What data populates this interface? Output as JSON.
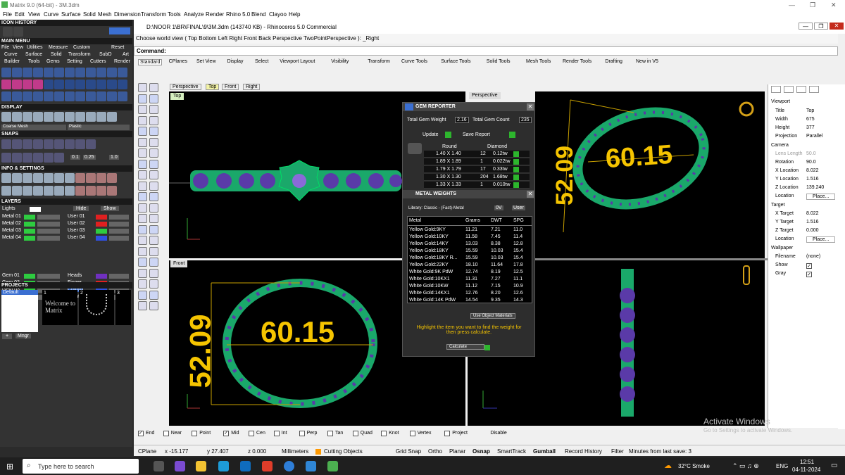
{
  "window": {
    "title": "Matrix 9.0 (64-bit) - 3M.3dm"
  },
  "menu": [
    "File",
    "Edit",
    "View",
    "Curve",
    "Surface",
    "Solid",
    "Mesh",
    "Dimension",
    "Transform",
    "Tools",
    "Analyze",
    "Render",
    "Rhino 5.0",
    "Blend",
    "Clayoo",
    "Help"
  ],
  "left": {
    "icon_history": "ICON HISTORY",
    "main_menu": "MAIN MENU",
    "main_menu_items": [
      "File",
      "View",
      "Utilities",
      "Measure",
      "Custom",
      "Reset"
    ],
    "row2": [
      "Curve",
      "Surface",
      "Solid",
      "Transform",
      "SubD",
      "Art"
    ],
    "row3": [
      "Builder",
      "Tools",
      "Gems",
      "Setting",
      "Cutters",
      "Render"
    ],
    "display": "DISPLAY",
    "display_modes": [
      "Coarse Mesh",
      "Plastic"
    ],
    "snaps": "SNAPS",
    "snap_vals": [
      "0.1",
      "0.25",
      "1.0"
    ],
    "info": "INFO & SETTINGS",
    "layers": "LAYERS",
    "lights": "Lights",
    "hide": "Hide",
    "show": "Show",
    "layer_names": [
      "Metal 01",
      "Metal 02",
      "Metal 03",
      "Metal 04",
      "Gem 01",
      "Gem 02",
      "Gem 03",
      "Gem 04"
    ],
    "user_names": [
      "User 01",
      "User 02",
      "User 03",
      "User 04",
      "Heads",
      "Finger",
      "Cutting",
      "Creation"
    ],
    "projects": "PROJECTS",
    "default": "Default",
    "thumbs": [
      "1",
      "2",
      "3"
    ],
    "welcome": "Welcome to Matrix",
    "mngr": "Mngr"
  },
  "rhino": {
    "title": "D:\\NOOR 1\\BR\\FINAL\\9\\3M.3dm (143740 KB) - Rhinoceros 5.0 Commercial",
    "cmd_history": "Choose world view ( Top  Bottom  Left  Right  Front  Back  Perspective  TwoPointPerspective ): _Right",
    "command_label": "Command:",
    "tabs": [
      "Standard",
      "CPlanes",
      "Set View",
      "Display",
      "Select",
      "Viewport Layout",
      "Visibility",
      "Transform",
      "Curve Tools",
      "Surface Tools",
      "Solid Tools",
      "Mesh Tools",
      "Render Tools",
      "Drafting",
      "New in V5"
    ],
    "vp_tabs": [
      "Perspective",
      "Top",
      "Front",
      "Right"
    ],
    "vp_top": "Top",
    "vp_persp": "Perspective",
    "vp_front": "Front",
    "dim_w": "60.15",
    "dim_h": "52.09"
  },
  "gem": {
    "title": "GEM REPORTER",
    "tgw_label": "Total Gem Weight",
    "tgw": "2.16",
    "tgc_label": "Total Gem Count",
    "tgc": "235",
    "update": "Update",
    "save": "Save Report",
    "col_round": "Round",
    "col_diamond": "Diamond",
    "rows": [
      {
        "size": "1.40 X 1.40",
        "count": "12",
        "tw": "0.12tw"
      },
      {
        "size": "1.89 X 1.89",
        "count": "1",
        "tw": "0.022tw"
      },
      {
        "size": "1.79 X 1.79",
        "count": "17",
        "tw": "0.33tw"
      },
      {
        "size": "1.30 X 1.30",
        "count": "204",
        "tw": "1.68tw"
      },
      {
        "size": "1.33 X 1.33",
        "count": "1",
        "tw": "0.010tw"
      }
    ],
    "metal_title": "METAL WEIGHTS",
    "library": "Library: Classic - (Fast)-Metal",
    "ov": "0V",
    "user": "User",
    "mcols": [
      "Metal",
      "Grams",
      "DWT",
      "SPG"
    ],
    "metals": [
      [
        "Yellow Gold:9KY",
        "11.21",
        "7.21",
        "11.0"
      ],
      [
        "Yellow Gold:10KY",
        "11.58",
        "7.45",
        "11.4"
      ],
      [
        "Yellow Gold:14KY",
        "13.03",
        "8.38",
        "12.8"
      ],
      [
        "Yellow Gold:18KY",
        "15.59",
        "10.03",
        "15.4"
      ],
      [
        "Yellow Gold:18KY R...",
        "15.59",
        "10.03",
        "15.4"
      ],
      [
        "Yellow Gold:22KY",
        "18.10",
        "11.64",
        "17.8"
      ],
      [
        "White Gold:9K PdW",
        "12.74",
        "8.19",
        "12.5"
      ],
      [
        "White Gold:10KX1",
        "11.31",
        "7.27",
        "11.1"
      ],
      [
        "White Gold:10KW",
        "11.12",
        "7.15",
        "10.9"
      ],
      [
        "White Gold:14KX1",
        "12.76",
        "8.20",
        "12.6"
      ],
      [
        "White Gold:14K PdW",
        "14.54",
        "9.35",
        "14.3"
      ]
    ],
    "use_obj": "Use Object Materials",
    "hint": "Highlight the item you want to find the weight for then press calculate.",
    "calc": "Calculate"
  },
  "props": {
    "viewport": "Viewport",
    "rows": [
      [
        "Title",
        "Top"
      ],
      [
        "Width",
        "675"
      ],
      [
        "Height",
        "377"
      ],
      [
        "Projection",
        "Parallel"
      ]
    ],
    "camera": "Camera",
    "cam": [
      [
        "Lens Length",
        "50.0"
      ],
      [
        "Rotation",
        "90.0"
      ],
      [
        "X Location",
        "8.022"
      ],
      [
        "Y Location",
        "1.516"
      ],
      [
        "Z Location",
        "139.240"
      ],
      [
        "Location",
        "Place..."
      ]
    ],
    "target": "Target",
    "tgt": [
      [
        "X Target",
        "8.022"
      ],
      [
        "Y Target",
        "1.516"
      ],
      [
        "Z Target",
        "0.000"
      ],
      [
        "Location",
        "Place..."
      ]
    ],
    "wallpaper": "Wallpaper",
    "wp": [
      [
        "Filename",
        "(none)"
      ],
      [
        "Show",
        ""
      ],
      [
        "Gray",
        ""
      ]
    ]
  },
  "osnaps": [
    "End",
    "Near",
    "Point",
    "Mid",
    "Cen",
    "Int",
    "Perp",
    "Tan",
    "Quad",
    "Knot",
    "Vertex",
    "Project",
    "Disable"
  ],
  "status": {
    "cplane": "CPlane",
    "x": "x -15.177",
    "y": "y 27.407",
    "z": "z 0.000",
    "units": "Millimeters",
    "layer": "Cutting Objects",
    "grid": "Grid Snap",
    "ortho": "Ortho",
    "planar": "Planar",
    "osnap": "Osnap",
    "smart": "SmartTrack",
    "gumball": "Gumball",
    "record": "Record History",
    "filter": "Filter",
    "save": "Minutes from last save: 3"
  },
  "activate": {
    "line1": "Activate Windows",
    "line2": "Go to Settings to activate Windows."
  },
  "taskbar": {
    "search": "Type here to search",
    "weather": "32°C  Smoke",
    "lang": "ENG",
    "time": "12:51",
    "date": "04-11-2024"
  },
  "colors": {
    "gem": "#5a3aa8",
    "metal": "#1aa86a",
    "dim": "#f5c400",
    "layer_green": "#2ecc40",
    "layer_red": "#e02020",
    "layer_blue": "#3050e0"
  }
}
